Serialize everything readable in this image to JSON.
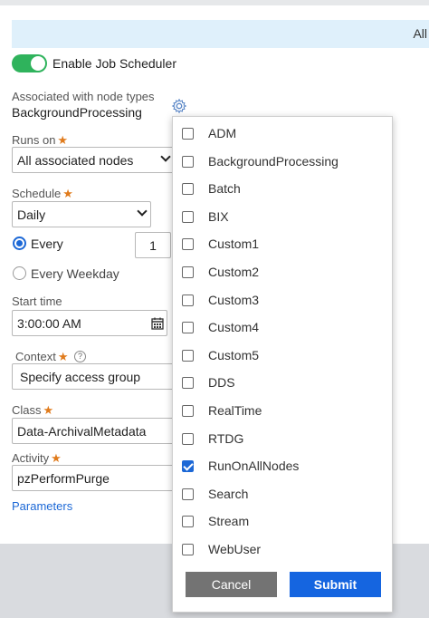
{
  "banner": {
    "text": "All"
  },
  "toggle": {
    "label": "Enable Job Scheduler",
    "on": true
  },
  "node_types": {
    "label": "Associated with node types",
    "value": "BackgroundProcessing",
    "icon": "gear-icon"
  },
  "runs_on": {
    "label": "Runs on",
    "value": "All associated nodes"
  },
  "schedule": {
    "label": "Schedule",
    "value": "Daily",
    "every_label": "Every",
    "every_value": "1",
    "weekday_label": "Every Weekday"
  },
  "start_time": {
    "label": "Start time",
    "value": "3:00:00 AM",
    "icon": "calendar-icon"
  },
  "context": {
    "label": "Context",
    "value": "Specify access group"
  },
  "class_field": {
    "label": "Class",
    "value": "Data-ArchivalMetadata"
  },
  "activity": {
    "label": "Activity",
    "value": "pzPerformPurge"
  },
  "parameters_link": "Parameters",
  "dropdown": {
    "options": [
      {
        "label": "ADM",
        "checked": false
      },
      {
        "label": "BackgroundProcessing",
        "checked": false
      },
      {
        "label": "Batch",
        "checked": false
      },
      {
        "label": "BIX",
        "checked": false
      },
      {
        "label": "Custom1",
        "checked": false
      },
      {
        "label": "Custom2",
        "checked": false
      },
      {
        "label": "Custom3",
        "checked": false
      },
      {
        "label": "Custom4",
        "checked": false
      },
      {
        "label": "Custom5",
        "checked": false
      },
      {
        "label": "DDS",
        "checked": false
      },
      {
        "label": "RealTime",
        "checked": false
      },
      {
        "label": "RTDG",
        "checked": false
      },
      {
        "label": "RunOnAllNodes",
        "checked": true
      },
      {
        "label": "Search",
        "checked": false
      },
      {
        "label": "Stream",
        "checked": false
      },
      {
        "label": "WebUser",
        "checked": false
      }
    ],
    "cancel_label": "Cancel",
    "submit_label": "Submit"
  }
}
